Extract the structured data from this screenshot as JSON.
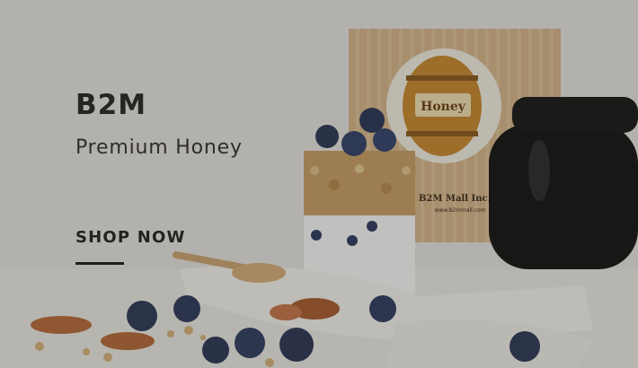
{
  "banner": {
    "brand": "B2M",
    "tagline": "Premium Honey",
    "cta_label": "SHOP NOW"
  },
  "product": {
    "box_label": "B2M Mall Inc.",
    "box_url": "www.b2mmall.com",
    "barrel_text": "Honey"
  },
  "colors": {
    "text_dark": "#262522",
    "honey_amber": "#c9892f",
    "box_wood": "#d8b88e",
    "jar_black": "#141414",
    "blueberry": "#2d3a5c"
  }
}
